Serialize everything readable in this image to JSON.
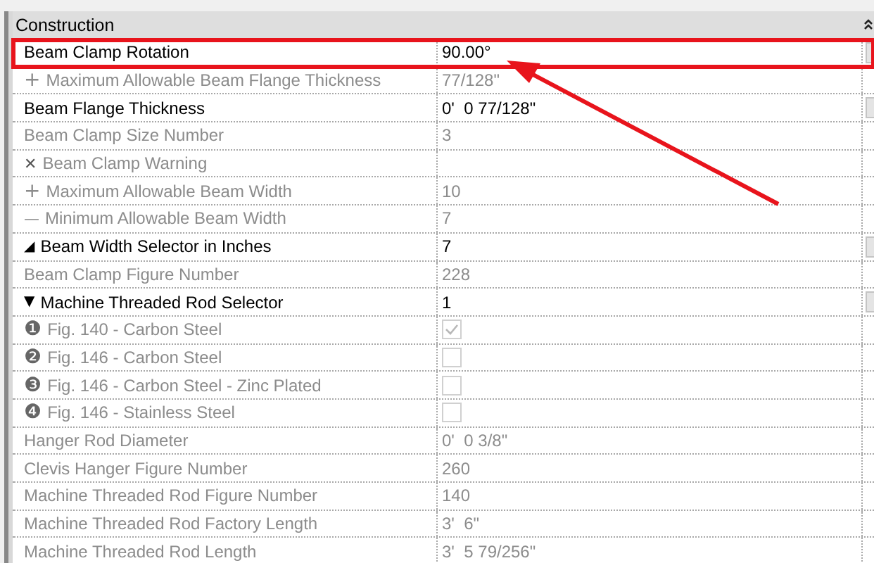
{
  "category": {
    "title": "Construction",
    "expanded": true
  },
  "rows": [
    {
      "label": "Beam Clamp Rotation",
      "value": "90.00°",
      "kind": "text",
      "editable": true,
      "highlighted": true
    },
    {
      "label": "Maximum Allowable Beam Flange Thickness",
      "marker": {
        "kind": "plus",
        "text": "+"
      },
      "value": "77/128\"",
      "kind": "text",
      "editable": false,
      "highlighted": false
    },
    {
      "label": "Beam Flange Thickness",
      "value": "0'  0 77/128\"",
      "kind": "text",
      "editable": true,
      "highlighted": false
    },
    {
      "label": "Beam Clamp Size Number",
      "value": "3",
      "kind": "text",
      "editable": false,
      "highlighted": false
    },
    {
      "label": "Beam Clamp Warning",
      "marker": {
        "kind": "cross",
        "text": "✕"
      },
      "value": "",
      "kind": "text",
      "editable": false,
      "highlighted": false
    },
    {
      "label": "Maximum Allowable Beam Width",
      "marker": {
        "kind": "plus",
        "text": "+"
      },
      "value": "10",
      "kind": "text",
      "editable": false,
      "highlighted": false
    },
    {
      "label": "Minimum Allowable Beam Width",
      "marker": {
        "kind": "minus",
        "text": "—"
      },
      "value": "7",
      "kind": "text",
      "editable": false,
      "highlighted": false
    },
    {
      "label": "Beam Width Selector in Inches",
      "marker": {
        "kind": "corner",
        "text": "◢"
      },
      "value": "7",
      "kind": "text",
      "editable": true,
      "highlighted": false
    },
    {
      "label": "Beam Clamp Figure Number",
      "value": "228",
      "kind": "text",
      "editable": false,
      "highlighted": false
    },
    {
      "label": "Machine Threaded Rod Selector",
      "marker": {
        "kind": "down",
        "text": "▼"
      },
      "value": "1",
      "kind": "text",
      "editable": true,
      "highlighted": false
    },
    {
      "label": "Fig. 140 - Carbon Steel",
      "marker": {
        "kind": "number",
        "text": "❶"
      },
      "kind": "checkbox",
      "checked": true,
      "editable": false,
      "highlighted": false
    },
    {
      "label": "Fig. 146 - Carbon Steel",
      "marker": {
        "kind": "number",
        "text": "❷"
      },
      "kind": "checkbox",
      "checked": false,
      "editable": false,
      "highlighted": false
    },
    {
      "label": "Fig. 146 - Carbon Steel - Zinc Plated",
      "marker": {
        "kind": "number",
        "text": "❸"
      },
      "kind": "checkbox",
      "checked": false,
      "editable": false,
      "highlighted": false
    },
    {
      "label": "Fig. 146 - Stainless Steel",
      "marker": {
        "kind": "number",
        "text": "❹"
      },
      "kind": "checkbox",
      "checked": false,
      "editable": false,
      "highlighted": false
    },
    {
      "label": "Hanger Rod Diameter",
      "value": "0'  0 3/8\"",
      "kind": "text",
      "editable": false,
      "highlighted": false
    },
    {
      "label": "Clevis Hanger Figure Number",
      "value": "260",
      "kind": "text",
      "editable": false,
      "highlighted": false
    },
    {
      "label": "Machine Threaded Rod Figure Number",
      "value": "140",
      "kind": "text",
      "editable": false,
      "highlighted": false
    },
    {
      "label": "Machine Threaded Rod Factory Length",
      "value": "3'  6\"",
      "kind": "text",
      "editable": false,
      "highlighted": false
    },
    {
      "label": "Machine Threaded Rod Length",
      "value": "3'  5 79/256\"",
      "kind": "text",
      "editable": false,
      "highlighted": false
    }
  ]
}
